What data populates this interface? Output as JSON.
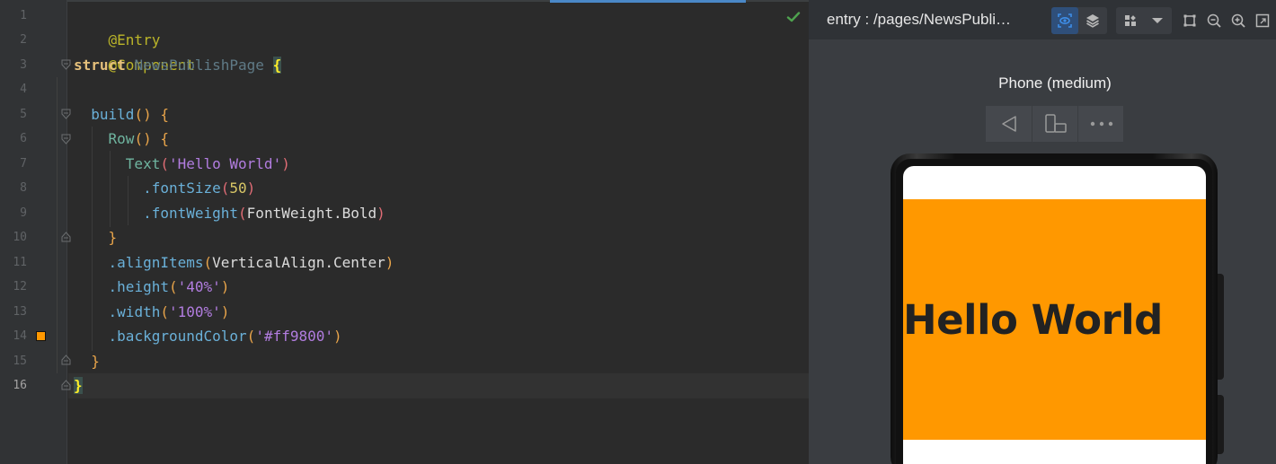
{
  "editor": {
    "line_numbers": [
      "1",
      "2",
      "3",
      "4",
      "5",
      "6",
      "7",
      "8",
      "9",
      "10",
      "11",
      "12",
      "13",
      "14",
      "15",
      "16"
    ],
    "current_line": "16",
    "status_icon": "check-icon",
    "color_swatch": "#ff9800",
    "lines": {
      "l1": {
        "ann": "@Entry"
      },
      "l2": {
        "ann": "@Component"
      },
      "l3": {
        "kw": "struct",
        "name": "NewsPublishPage",
        "brace": "{"
      },
      "l5": {
        "fn": "build",
        "paren": "()",
        "brace": "{"
      },
      "l6": {
        "comp": "Row",
        "paren": "()",
        "brace": "{"
      },
      "l7": {
        "comp": "Text",
        "open": "(",
        "str": "'Hello World'",
        "close": ")"
      },
      "l8": {
        "dot": ".",
        "method": "fontSize",
        "open": "(",
        "num": "50",
        "close": ")"
      },
      "l9": {
        "dot": ".",
        "method": "fontWeight",
        "open": "(",
        "arg": "FontWeight.Bold",
        "close": ")"
      },
      "l10": {
        "brace": "}"
      },
      "l11": {
        "dot": ".",
        "method": "alignItems",
        "open": "(",
        "arg": "VerticalAlign.Center",
        "close": ")"
      },
      "l12": {
        "dot": ".",
        "method": "height",
        "open": "(",
        "str": "'40%'",
        "close": ")"
      },
      "l13": {
        "dot": ".",
        "method": "width",
        "open": "(",
        "str": "'100%'",
        "close": ")"
      },
      "l14": {
        "dot": ".",
        "method": "backgroundColor",
        "open": "(",
        "str": "'#ff9800'",
        "close": ")"
      },
      "l15": {
        "brace": "}"
      },
      "l16": {
        "brace": "}"
      }
    }
  },
  "preview": {
    "title": "entry : /pages/NewsPubli…",
    "toolbar_icons": [
      "inspector-icon",
      "layers-icon",
      "components-icon",
      "dropdown-icon",
      "fit-icon",
      "zoom-out-icon",
      "zoom-in-icon",
      "fullscreen-icon"
    ],
    "device_name": "Phone (medium)",
    "device_buttons": [
      "back-icon",
      "rotate-icon",
      "more-icon"
    ],
    "screen": {
      "text": "Hello World",
      "row_color": "#ff9800"
    }
  }
}
